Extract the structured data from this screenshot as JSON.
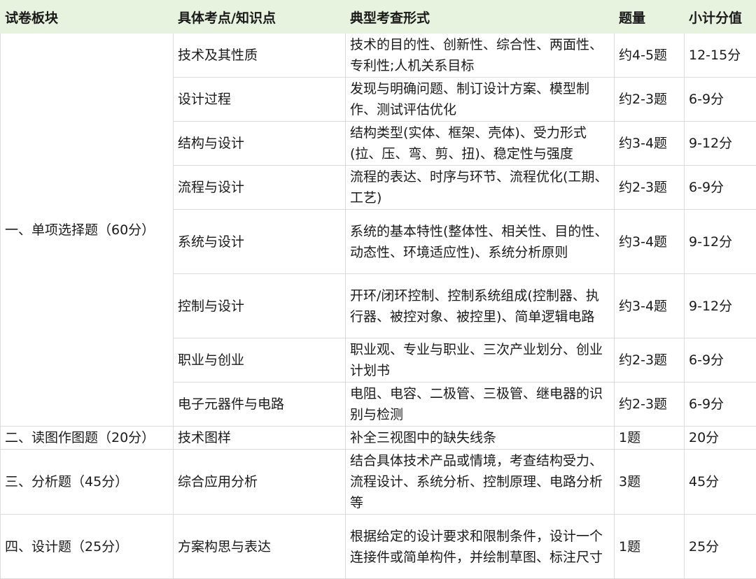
{
  "headers": [
    "试卷板块",
    "具体考点/知识点",
    "典型考查形式",
    "题量",
    "小计分值"
  ],
  "sections": [
    {
      "name": "一、单项选择题（60分）",
      "rows": [
        {
          "topic": "技术及其性质",
          "form": "技术的目的性、创新性、综合性、两面性、专利性;人机关系目标",
          "count": "约4-5题",
          "score": "12-15分"
        },
        {
          "topic": "设计过程",
          "form": "发现与明确问题、制订设计方案、模型制作、测试评估优化",
          "count": "约2-3题",
          "score": "6-9分"
        },
        {
          "topic": "结构与设计",
          "form": "结构类型(实体、框架、壳体)、受力形式(拉、压、弯、剪、扭)、稳定性与强度",
          "count": "约3-4题",
          "score": "9-12分"
        },
        {
          "topic": "流程与设计",
          "form": "流程的表达、时序与环节、流程优化(工期、工艺)",
          "count": "约2-3题",
          "score": "6-9分"
        },
        {
          "topic": "系统与设计",
          "form": "系统的基本特性(整体性、相关性、目的性、动态性、环境适应性)、系统分析原则",
          "count": "约3-4题",
          "score": "9-12分"
        },
        {
          "topic": "控制与设计",
          "form": "开环/闭环控制、控制系统组成(控制器、执行器、被控对象、被控里)、简单逻辑电路",
          "count": "约3-4题",
          "score": "9-12分"
        },
        {
          "topic": "职业与创业",
          "form": "职业观、专业与职业、三次产业划分、创业计划书",
          "count": "约2-3题",
          "score": "6-9分"
        },
        {
          "topic": "电子元器件与电路",
          "form": "电阻、电容、二极管、三极管、继电器的识别与检测",
          "count": "约2-3题",
          "score": "6-9分"
        }
      ]
    },
    {
      "name": "二、读图作图题（20分）",
      "rows": [
        {
          "topic": "技术图样",
          "form": "补全三视图中的缺失线条",
          "count": "1题",
          "score": "20分"
        }
      ]
    },
    {
      "name": "三、分析题（45分）",
      "rows": [
        {
          "topic": "综合应用分析",
          "form": "结合具体技术产品或情境，考查结构受力、流程设计、系统分析、控制原理、电路分析等",
          "count": "3题",
          "score": "45分"
        }
      ]
    },
    {
      "name": "四、设计题（25分）",
      "rows": [
        {
          "topic": "方案构思与表达",
          "form": "根据给定的设计要求和限制条件，设计一个连接件或简单构件，并绘制草图、标注尺寸",
          "count": "1题",
          "score": "25分"
        }
      ]
    }
  ]
}
